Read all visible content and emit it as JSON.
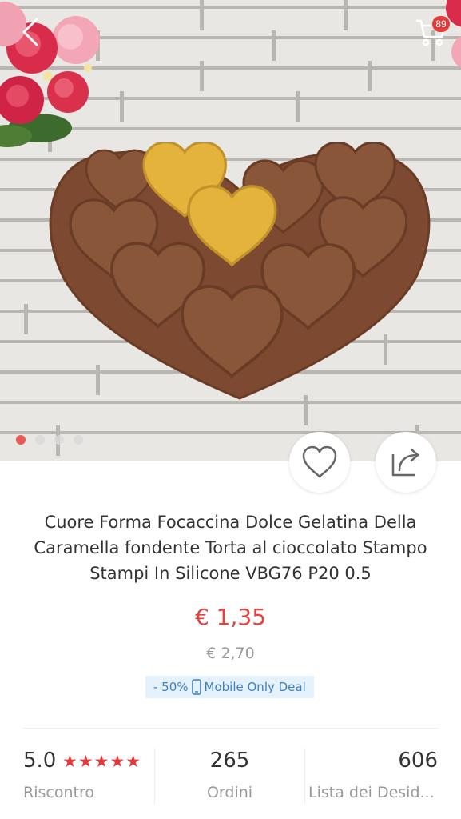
{
  "header": {
    "back_icon": "chevron-left-icon",
    "cart_icon": "cart-icon",
    "cart_count": "89"
  },
  "gallery": {
    "image_description": "heart-shaped chocolate silicone mold",
    "dot_count": 4,
    "active_index": 0,
    "wishlist_icon": "heart-outline-icon",
    "share_icon": "share-icon"
  },
  "product": {
    "title": "Cuore Forma Focaccina Dolce Gelatina Della Caramella fondente Torta al cioccolato Stampo Stampi In Silicone VBG76 P20 0.5",
    "price": "€ 1,35",
    "old_price": "€ 2,70",
    "discount": "- 50%",
    "deal_label": "Mobile Only Deal"
  },
  "stats": {
    "rating": "5.0",
    "stars": "★★★★★",
    "rating_label": "Riscontro",
    "orders": "265",
    "orders_label": "Ordini",
    "wishlist": "606",
    "wishlist_label": "Lista dei Desid..."
  },
  "colors": {
    "accent": "#e64340",
    "deal_bg": "#e5f1fb",
    "deal_text": "#3f7fc1"
  }
}
